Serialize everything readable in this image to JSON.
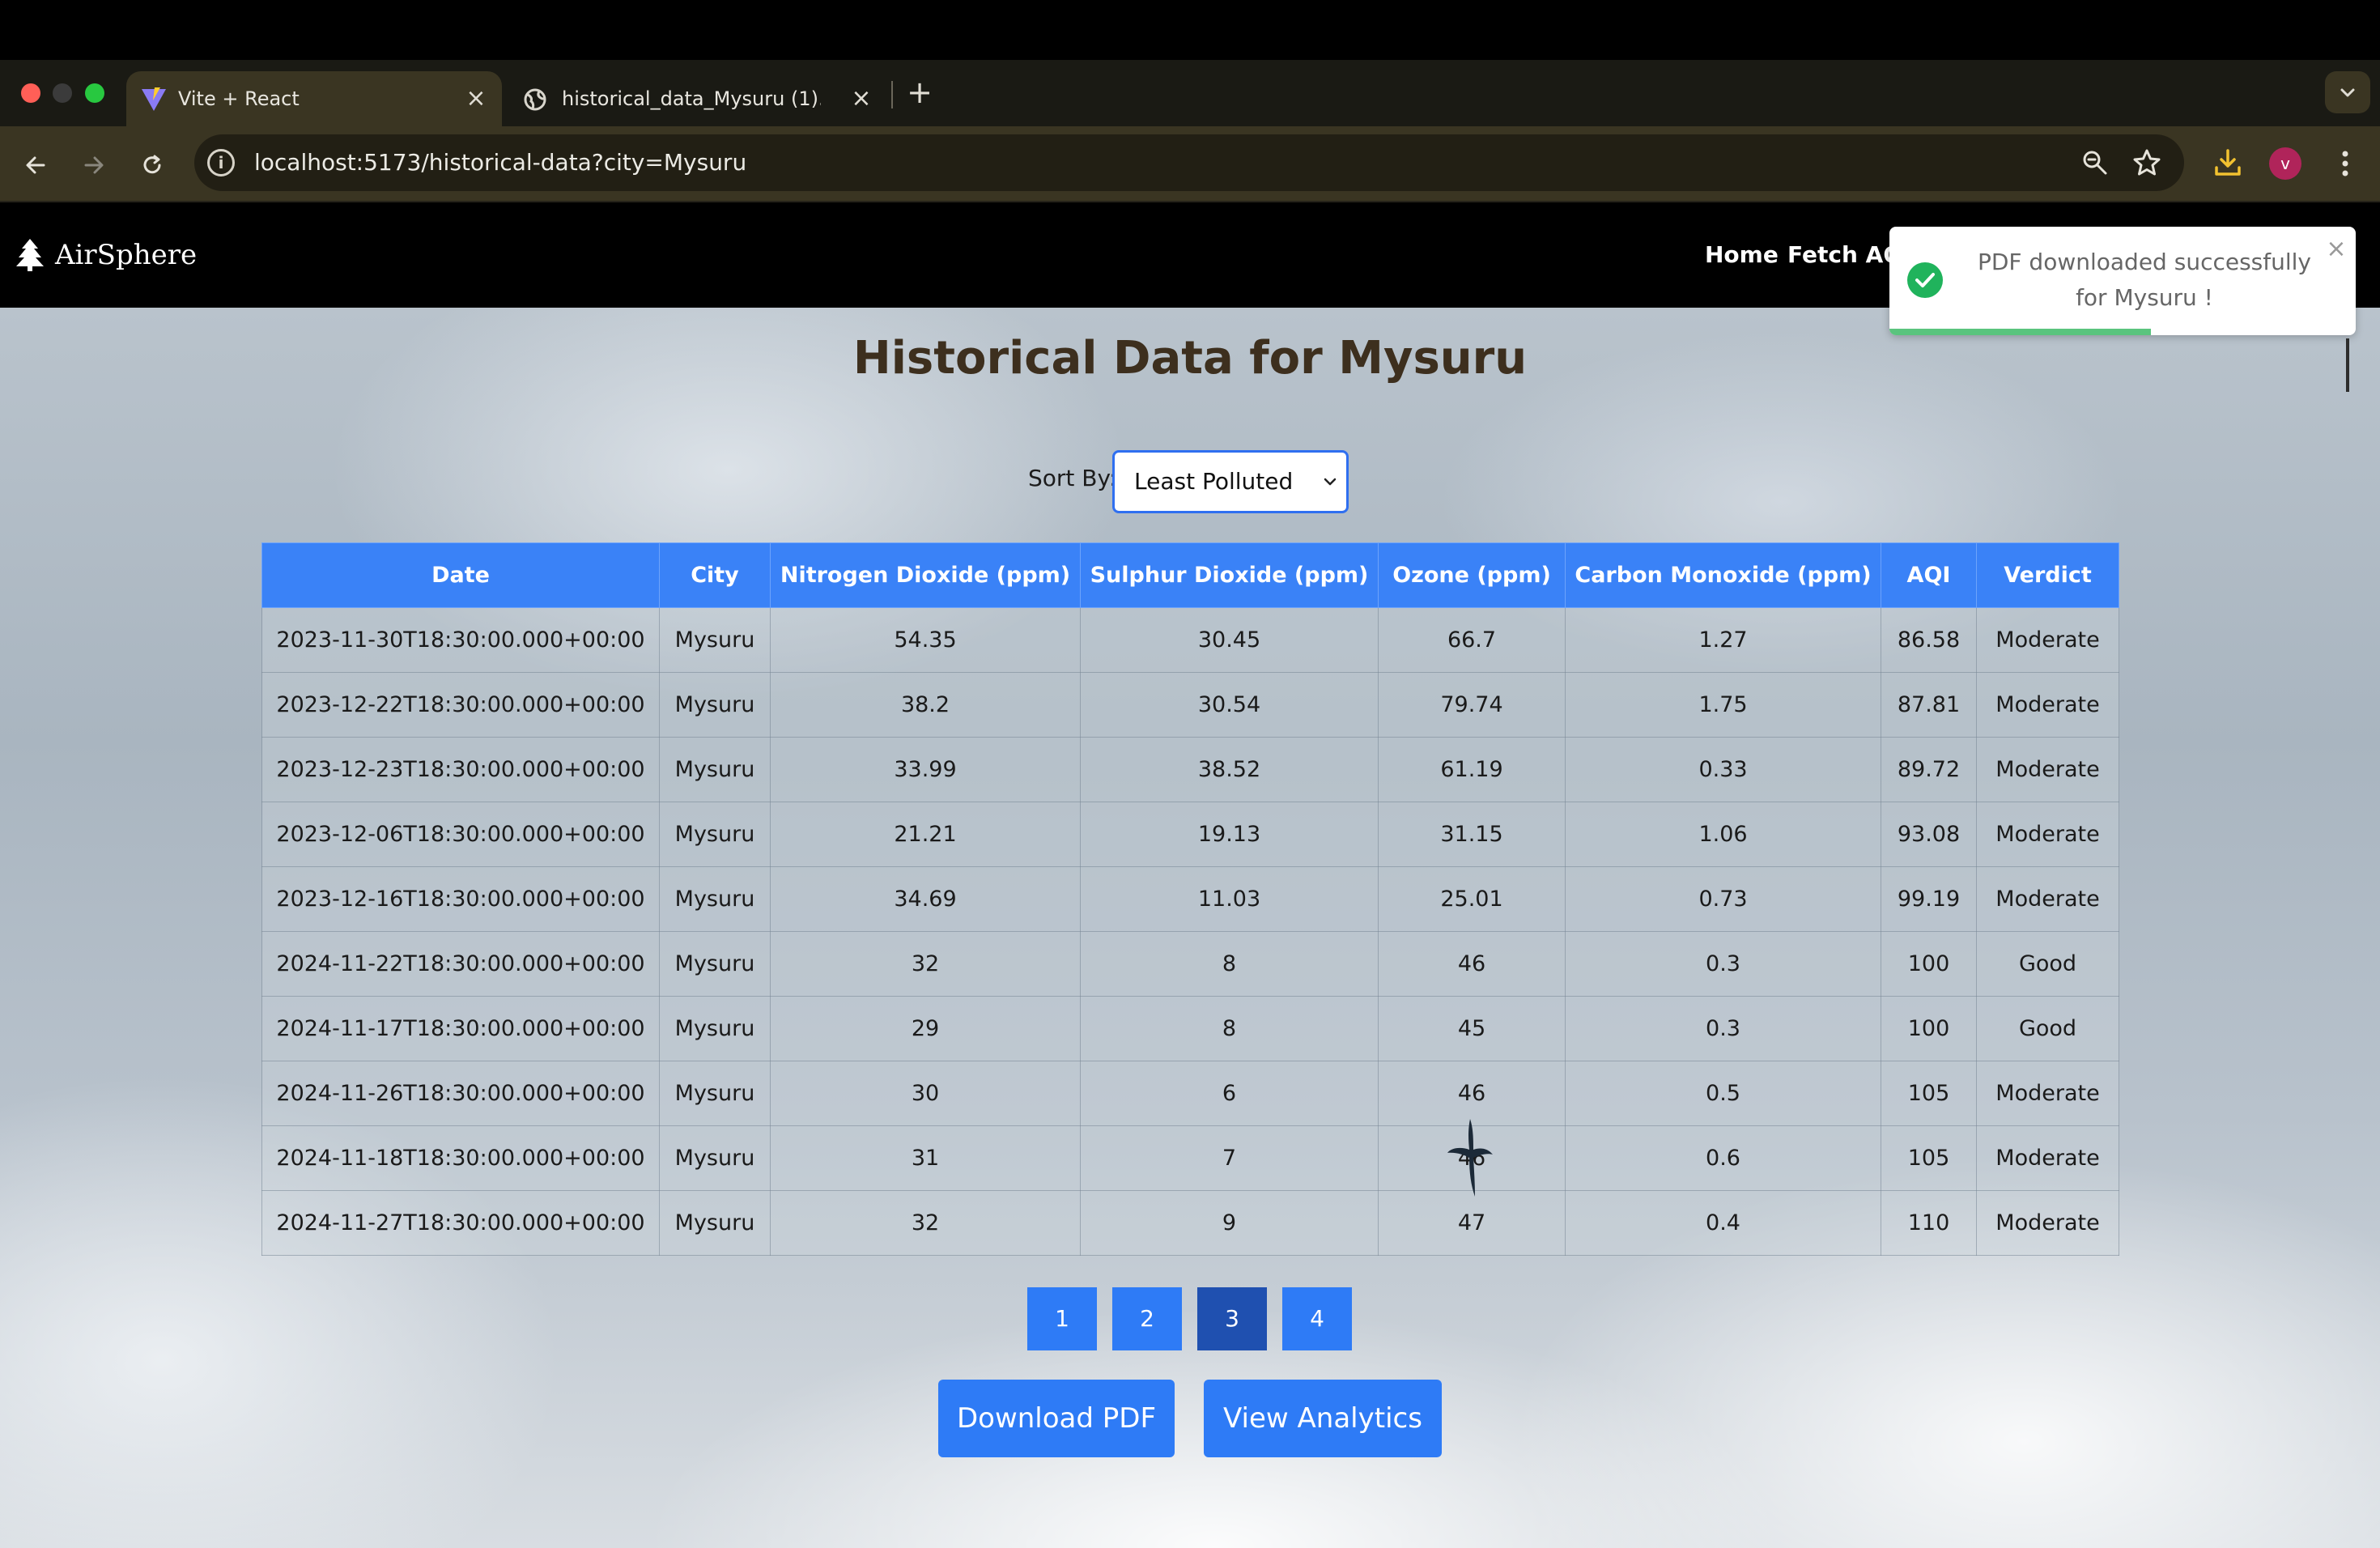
{
  "browser": {
    "tabs": [
      {
        "title": "Vite + React",
        "active": true,
        "favicon": "vite-icon"
      },
      {
        "title": "historical_data_Mysuru (1).pdf",
        "active": false,
        "favicon": "globe-icon"
      }
    ],
    "url": "localhost:5173/historical-data?city=Mysuru",
    "profile_initial": "v",
    "colors": {
      "tab_active": "#3a3522",
      "toolbar": "#3a3522",
      "avatar": "#b0245a"
    }
  },
  "site": {
    "brand": "AirSphere",
    "nav": [
      "Home",
      "Fetch AQI"
    ]
  },
  "toast": {
    "message": "PDF downloaded successfully for Mysuru !",
    "type": "success",
    "progress_fraction": 0.56,
    "color": "#20b35c"
  },
  "page": {
    "title": "Historical Data for Mysuru",
    "sort_label": "Sort By:",
    "sort_value": "Least Polluted"
  },
  "table": {
    "columns": [
      "Date",
      "City",
      "Nitrogen Dioxide (ppm)",
      "Sulphur Dioxide (ppm)",
      "Ozone (ppm)",
      "Carbon Monoxide (ppm)",
      "AQI",
      "Verdict"
    ],
    "rows": [
      [
        "2023-11-30T18:30:00.000+00:00",
        "Mysuru",
        "54.35",
        "30.45",
        "66.7",
        "1.27",
        "86.58",
        "Moderate"
      ],
      [
        "2023-12-22T18:30:00.000+00:00",
        "Mysuru",
        "38.2",
        "30.54",
        "79.74",
        "1.75",
        "87.81",
        "Moderate"
      ],
      [
        "2023-12-23T18:30:00.000+00:00",
        "Mysuru",
        "33.99",
        "38.52",
        "61.19",
        "0.33",
        "89.72",
        "Moderate"
      ],
      [
        "2023-12-06T18:30:00.000+00:00",
        "Mysuru",
        "21.21",
        "19.13",
        "31.15",
        "1.06",
        "93.08",
        "Moderate"
      ],
      [
        "2023-12-16T18:30:00.000+00:00",
        "Mysuru",
        "34.69",
        "11.03",
        "25.01",
        "0.73",
        "99.19",
        "Moderate"
      ],
      [
        "2024-11-22T18:30:00.000+00:00",
        "Mysuru",
        "32",
        "8",
        "46",
        "0.3",
        "100",
        "Good"
      ],
      [
        "2024-11-17T18:30:00.000+00:00",
        "Mysuru",
        "29",
        "8",
        "45",
        "0.3",
        "100",
        "Good"
      ],
      [
        "2024-11-26T18:30:00.000+00:00",
        "Mysuru",
        "30",
        "6",
        "46",
        "0.5",
        "105",
        "Moderate"
      ],
      [
        "2024-11-18T18:30:00.000+00:00",
        "Mysuru",
        "31",
        "7",
        "46",
        "0.6",
        "105",
        "Moderate"
      ],
      [
        "2024-11-27T18:30:00.000+00:00",
        "Mysuru",
        "32",
        "9",
        "47",
        "0.4",
        "110",
        "Moderate"
      ]
    ],
    "header_color": "#3a82f7"
  },
  "pagination": {
    "pages": [
      "1",
      "2",
      "3",
      "4"
    ],
    "current": "3"
  },
  "actions": {
    "download_pdf": "Download PDF",
    "view_analytics": "View Analytics"
  }
}
